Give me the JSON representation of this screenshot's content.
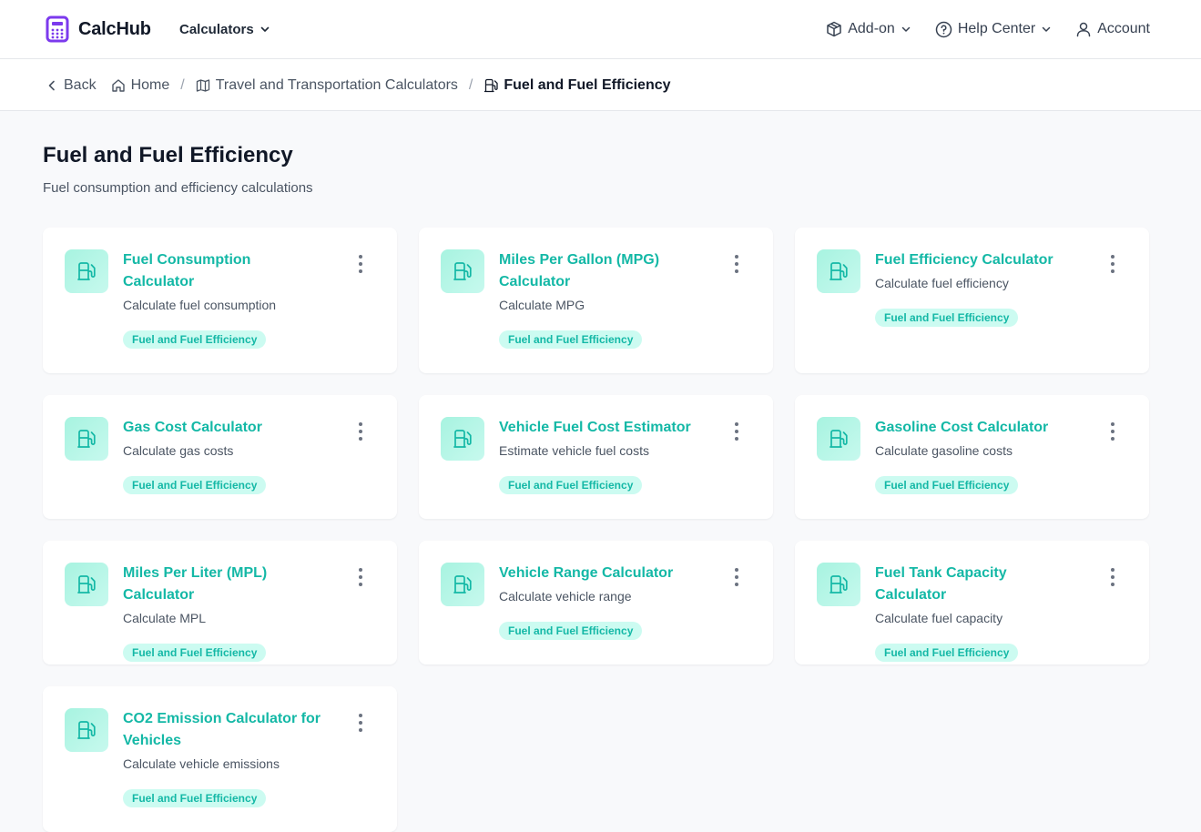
{
  "header": {
    "brand": "CalcHub",
    "nav_calculators": "Calculators",
    "addon": "Add-on",
    "help": "Help Center",
    "account": "Account",
    "brand_color": "#7c3aed"
  },
  "breadcrumb": {
    "back": "Back",
    "home": "Home",
    "category": "Travel and Transportation Calculators",
    "current": "Fuel and Fuel Efficiency"
  },
  "page": {
    "title": "Fuel and Fuel Efficiency",
    "subtitle": "Fuel consumption and efficiency calculations"
  },
  "accent_color": "#14b8a6",
  "cards": [
    {
      "title": "Fuel Consumption Calculator",
      "desc": "Calculate fuel consumption",
      "tag": "Fuel and Fuel Efficiency"
    },
    {
      "title": "Miles Per Gallon (MPG) Calculator",
      "desc": "Calculate MPG",
      "tag": "Fuel and Fuel Efficiency"
    },
    {
      "title": "Fuel Efficiency Calculator",
      "desc": "Calculate fuel efficiency",
      "tag": "Fuel and Fuel Efficiency"
    },
    {
      "title": "Gas Cost Calculator",
      "desc": "Calculate gas costs",
      "tag": "Fuel and Fuel Efficiency"
    },
    {
      "title": "Vehicle Fuel Cost Estimator",
      "desc": "Estimate vehicle fuel costs",
      "tag": "Fuel and Fuel Efficiency"
    },
    {
      "title": "Gasoline Cost Calculator",
      "desc": "Calculate gasoline costs",
      "tag": "Fuel and Fuel Efficiency"
    },
    {
      "title": "Miles Per Liter (MPL) Calculator",
      "desc": "Calculate MPL",
      "tag": "Fuel and Fuel Efficiency"
    },
    {
      "title": "Vehicle Range Calculator",
      "desc": "Calculate vehicle range",
      "tag": "Fuel and Fuel Efficiency"
    },
    {
      "title": "Fuel Tank Capacity Calculator",
      "desc": "Calculate fuel capacity",
      "tag": "Fuel and Fuel Efficiency"
    },
    {
      "title": "CO2 Emission Calculator for Vehicles",
      "desc": "Calculate vehicle emissions",
      "tag": "Fuel and Fuel Efficiency"
    }
  ]
}
